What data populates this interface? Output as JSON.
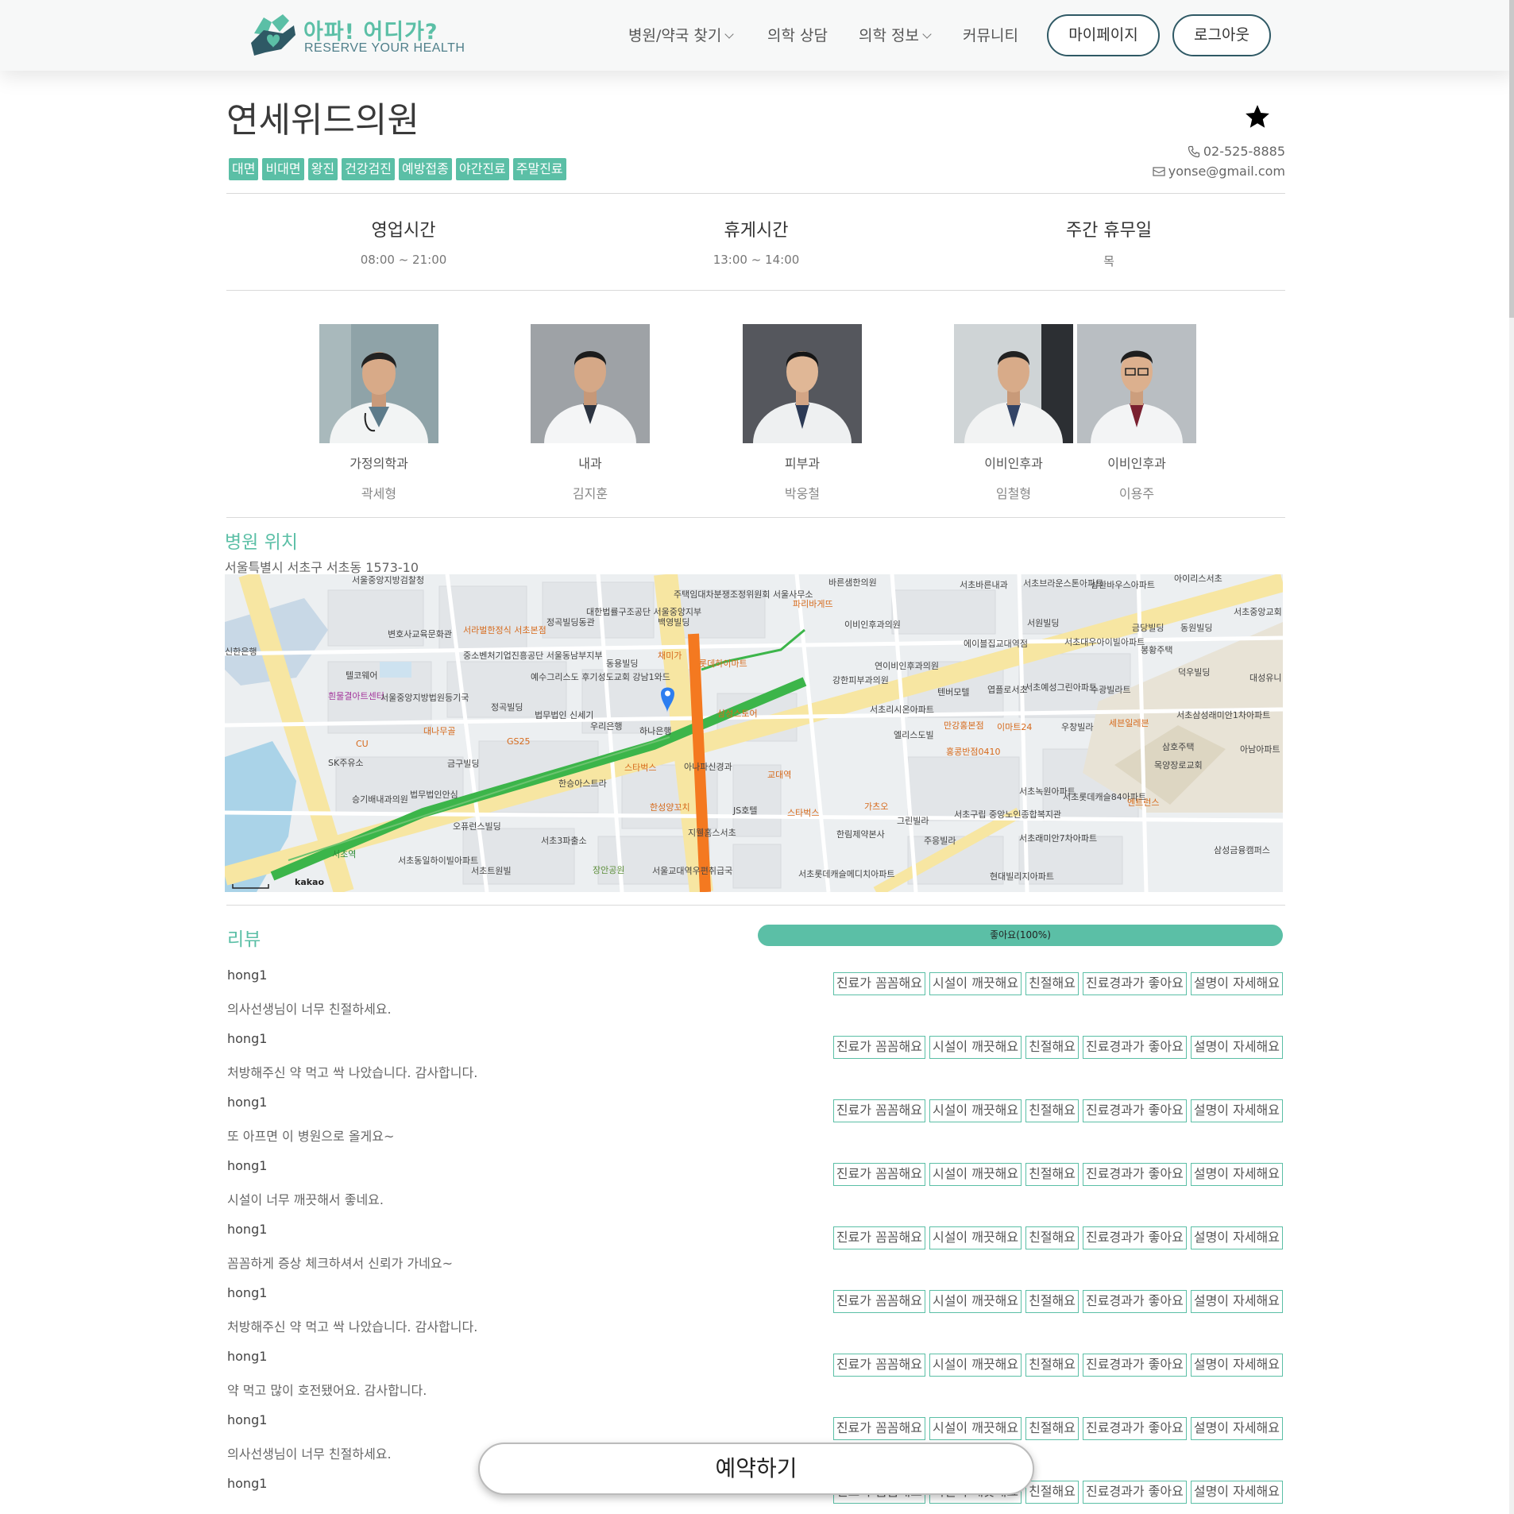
{
  "header": {
    "logo_title": "아파! 어디가?",
    "logo_subtitle": "RESERVE YOUR HEALTH",
    "nav": [
      {
        "label": "병원/약국 찾기",
        "dropdown": true
      },
      {
        "label": "의학 상담",
        "dropdown": false
      },
      {
        "label": "의학 정보",
        "dropdown": true
      },
      {
        "label": "커뮤니티",
        "dropdown": false
      }
    ],
    "mypage_label": "마이페이지",
    "logout_label": "로그아웃"
  },
  "hospital": {
    "name": "연세위드의원",
    "favorite_icon": "star-icon",
    "tags": [
      "대면",
      "비대면",
      "왕진",
      "건강검진",
      "예방접종",
      "야간진료",
      "주말진료"
    ],
    "phone": "02-525-8885",
    "email": "yonse@gmail.com"
  },
  "hours": [
    {
      "title": "영업시간",
      "value": "08:00 ~ 21:00"
    },
    {
      "title": "휴게시간",
      "value": "13:00 ~ 14:00"
    },
    {
      "title": "주간 휴무일",
      "value": "목"
    }
  ],
  "doctors": [
    {
      "dept": "가정의학과",
      "name": "곽세형"
    },
    {
      "dept": "내과",
      "name": "김지훈"
    },
    {
      "dept": "피부과",
      "name": "박웅철"
    },
    {
      "dept": "이비인후과",
      "name": "임철형"
    },
    {
      "dept": "이비인후과",
      "name": "이용주"
    }
  ],
  "location": {
    "title": "병원 위치",
    "address": "서울특별시 서초구 서초동 1573-10",
    "map_labels": [
      "서울중앙지방검찰청",
      "변호사교육문화관",
      "서라벌한정식 서초본점",
      "중소벤처기업진흥공단 서울동남부지부",
      "정곡빌딩동관",
      "대한법률구조공단 서울중앙지부",
      "백영빌딩",
      "주택임대차분쟁조정위원회 서울사무소",
      "바른샘한의원",
      "파리바게뜨",
      "서초바른내과",
      "서초브라운스톤아파트",
      "삼환바우스아파트",
      "아이리스서초",
      "서초중앙교회",
      "신한은행",
      "텔코웨어",
      "흰물결아트센터",
      "서울중앙지방법원등기국",
      "정곡빌딩",
      "채미가",
      "롯데하이마트",
      "동용빌딩",
      "예수그리스도 후기성도교회 강남1와드",
      "이비인후과의원",
      "연이비인후과의원",
      "강한피부과의원",
      "에이블집교대역점",
      "서원빌딩",
      "서초대우아이빌아파트",
      "금당빌딩",
      "동원빌딩",
      "봉황주택",
      "덕우빌딩",
      "대성유니",
      "CU",
      "대나무골",
      "GS25",
      "법무법인 신세기",
      "우리은행",
      "하나은행",
      "삼성스토어",
      "서초리시온아파트",
      "텐버모텔",
      "엽플로서초",
      "서초예성그린아파트",
      "수광빌라트",
      "서초삼성래미안1차아파트",
      "엘리스도빌",
      "만강홍본점",
      "이마트24",
      "우창빌라",
      "세븐일레븐",
      "SK주유소",
      "금구빌딩",
      "스타벅스",
      "아나파신경과",
      "홍콩반점0410",
      "삼호주택",
      "목양장로교회",
      "아남아파트",
      "법무법인안심",
      "승기배내과의원",
      "한승아스트라",
      "교대역",
      "서초녹원아파트",
      "서초롯데캐슬84아파트",
      "엔트런스",
      "오퓨런스빌딩",
      "한성양꼬치",
      "JS호텔",
      "스타벅스",
      "가츠오",
      "서초구립 중앙노인종합복지관",
      "그린빌라",
      "서초래미안7차아파트",
      "삼성금융캠퍼스",
      "서초동일하이빌아파트",
      "서초트원빌",
      "서초3파출소",
      "장안공원",
      "지웰홈스서초",
      "한림제약본사",
      "주응빌라",
      "서울교대역우편취급국",
      "서초롯데캐슬메디치아파트",
      "현대빌리지아파트",
      "서초역",
      "kakao"
    ]
  },
  "reviews": {
    "title": "리뷰",
    "ratio_label": "좋아요(100%)",
    "ratio_value": 1.0,
    "chip_labels": [
      "진료가 꼼꼼해요",
      "시설이 깨끗해요",
      "친절해요",
      "진료경과가 좋아요",
      "설명이 자세해요"
    ],
    "items": [
      {
        "user": "hong1",
        "text": "의사선생님이 너무 친절하세요."
      },
      {
        "user": "hong1",
        "text": "처방해주신 약 먹고 싹 나았습니다. 감사합니다."
      },
      {
        "user": "hong1",
        "text": "또 아프면 이 병원으로 올게요~"
      },
      {
        "user": "hong1",
        "text": "시설이 너무 깨끗해서 좋네요."
      },
      {
        "user": "hong1",
        "text": "꼼꼼하게 증상 체크하셔서 신뢰가 가네요~"
      },
      {
        "user": "hong1",
        "text": "처방해주신 약 먹고 싹 나았습니다. 감사합니다."
      },
      {
        "user": "hong1",
        "text": "약 먹고 많이 호전됐어요. 감사합니다."
      },
      {
        "user": "hong1",
        "text": "의사선생님이 너무 친절하세요."
      },
      {
        "user": "hong1",
        "text": ""
      }
    ]
  },
  "reserve_label": "예약하기",
  "colors": {
    "accent": "#5bbfa6",
    "dark": "#2f5965",
    "subway_green": "#3cb54a",
    "subway_orange": "#f47920"
  }
}
